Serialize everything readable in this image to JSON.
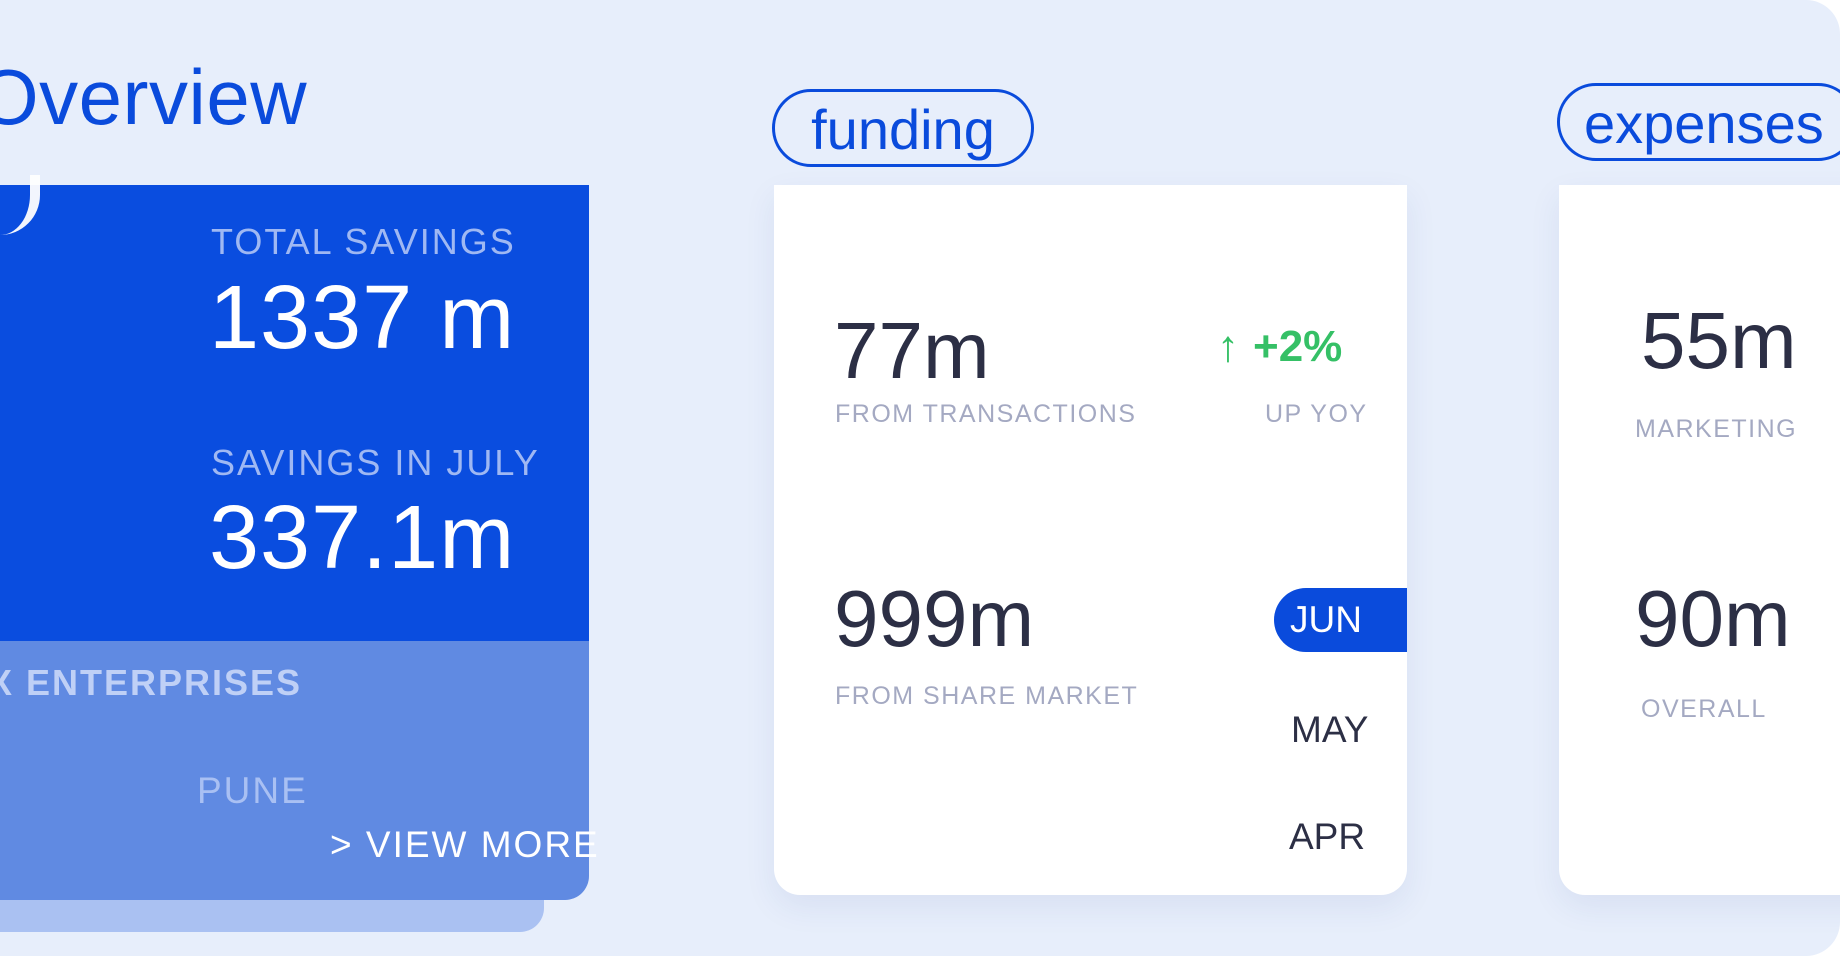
{
  "overview": {
    "title": "Overview",
    "total_savings_label": "TOTAL SAVINGS",
    "total_savings_value": "1337 m",
    "savings_july_label": "SAVINGS IN JULY",
    "savings_july_value": "337.1m",
    "company": "X ENTERPRISES",
    "city": "PUNE",
    "view_more": "> VIEW MORE"
  },
  "funding": {
    "pill": "funding",
    "transactions_value": "77m",
    "transactions_label": "FROM TRANSACTIONS",
    "growth_arrow": "↑",
    "growth_value": "+2%",
    "growth_label": "UP YOY",
    "share_value": "999m",
    "share_label": "FROM SHARE MARKET",
    "months": [
      "JUN",
      "MAY",
      "APR"
    ],
    "active_month": "JUN"
  },
  "expenses": {
    "pill": "expenses",
    "marketing_value": "55m",
    "marketing_label": "MARKETING",
    "overall_value": "90m",
    "overall_label": "OVERALL"
  },
  "colors": {
    "accent": "#0a4bdc",
    "background": "#e7eefb",
    "positive": "#35c066"
  }
}
